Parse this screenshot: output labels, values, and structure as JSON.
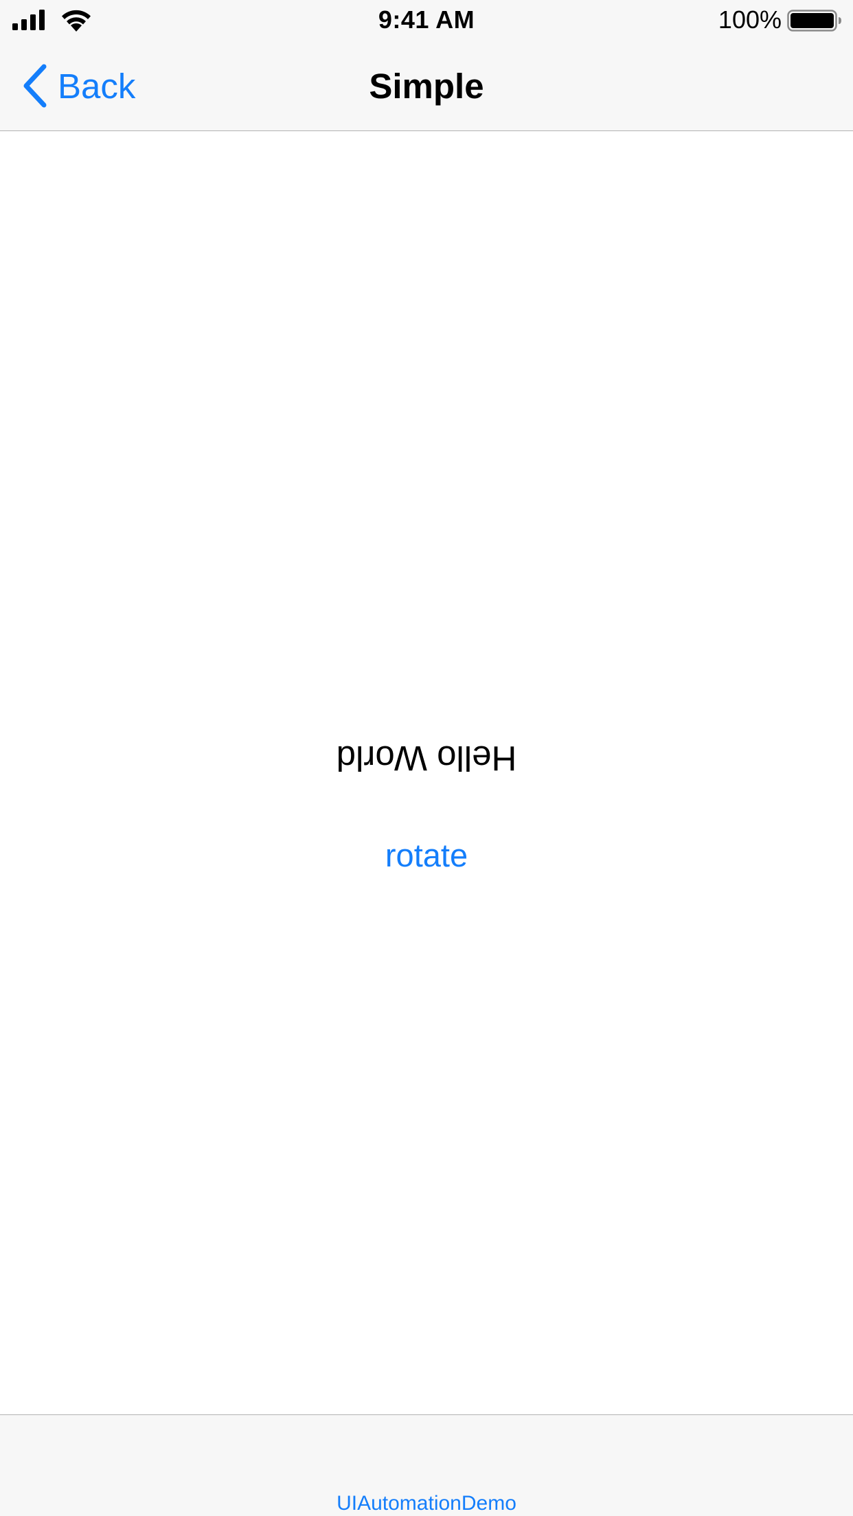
{
  "status_bar": {
    "time": "9:41 AM",
    "battery_percent": "100%",
    "icons": [
      "signal-icon",
      "wifi-icon",
      "battery-icon"
    ]
  },
  "nav_bar": {
    "back_label": "Back",
    "title": "Simple"
  },
  "content": {
    "hello_text": "Hello World",
    "rotate_label": "rotate"
  },
  "tab_bar": {
    "tab_label": "UIAutomationDemo"
  },
  "colors": {
    "accent": "#147efb",
    "chrome_background": "#f7f7f7",
    "separator": "#b2b2b2",
    "text": "#000000"
  }
}
